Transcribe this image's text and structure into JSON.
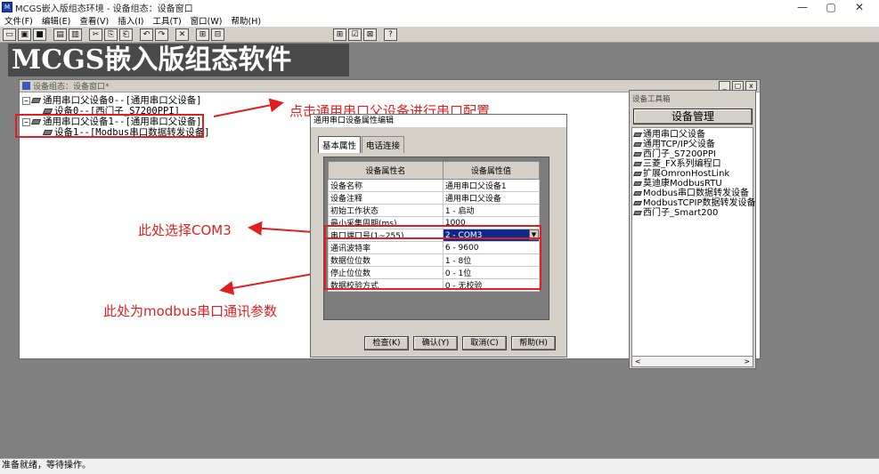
{
  "app": {
    "title": "MCGS嵌入版组态环境 - 设备组态：设备窗口",
    "icon_text": "M",
    "window_controls": [
      "—",
      "▢",
      "✕"
    ]
  },
  "menu": [
    "文件(F)",
    "编辑(E)",
    "查看(V)",
    "插入(I)",
    "工具(T)",
    "窗口(W)",
    "帮助(H)"
  ],
  "toolbar": {
    "group1": [
      "▭",
      "▣",
      "■",
      "▤",
      "▥",
      "✂",
      "⎘",
      "⎗",
      "↶",
      "↷",
      "✕",
      "⊞",
      "⊟"
    ],
    "group2": [
      "⊞",
      "☑",
      "⊠",
      "?"
    ]
  },
  "banner": "MCGS嵌入版组态软件",
  "child_window": {
    "title": "设备组态：设备窗口*",
    "controls": [
      "_",
      "▢",
      "x"
    ],
    "tree": [
      {
        "exp": "−",
        "label": "通用串口父设备0--[通用串口父设备]"
      },
      {
        "label": "设备0--[西门子_S7200PPI]"
      },
      {
        "exp": "−",
        "label": "通用串口父设备1--[通用串口父设备]"
      },
      {
        "label": "设备1--[Modbus串口数据转发设备]"
      }
    ]
  },
  "annotations": {
    "top": "点击通用串口父设备进行串口配置",
    "com": "此处选择COM3",
    "params": "此处为modbus串口通讯参数"
  },
  "dialog": {
    "title": "通用串口设备属性编辑",
    "tabs": [
      "基本属性",
      "电话连接"
    ],
    "headers": [
      "设备属性名",
      "设备属性值"
    ],
    "rows": [
      [
        "设备名称",
        "通用串口父设备1"
      ],
      [
        "设备注释",
        "通用串口父设备"
      ],
      [
        "初始工作状态",
        "1 - 启动"
      ],
      [
        "最小采集周期(ms)",
        "1000"
      ],
      [
        "串口端口号(1~255)",
        "2 - COM3"
      ],
      [
        "通讯波特率",
        "6 - 9600"
      ],
      [
        "数据位位数",
        "1 - 8位"
      ],
      [
        "停止位位数",
        "0 - 1位"
      ],
      [
        "数据校验方式",
        "0 - 无校验"
      ]
    ],
    "buttons": [
      "检查(K)",
      "确认(Y)",
      "取消(C)",
      "帮助(H)"
    ]
  },
  "toolbox": {
    "title": "设备工具箱",
    "button": "设备管理",
    "items": [
      "通用串口父设备",
      "通用TCP/IP父设备",
      "西门子_S7200PPI",
      "三菱_FX系列编程口",
      "扩展OmronHostLink",
      "莫迪康ModbusRTU",
      "Modbus串口数据转发设备",
      "ModbusTCPIP数据转发设备",
      "西门子_Smart200"
    ],
    "scroll_left": "<",
    "scroll_right": ">"
  },
  "status": "准备就绪，等待操作。",
  "colors": {
    "annotation": "#e02020",
    "selection": "#0a2a8c"
  }
}
